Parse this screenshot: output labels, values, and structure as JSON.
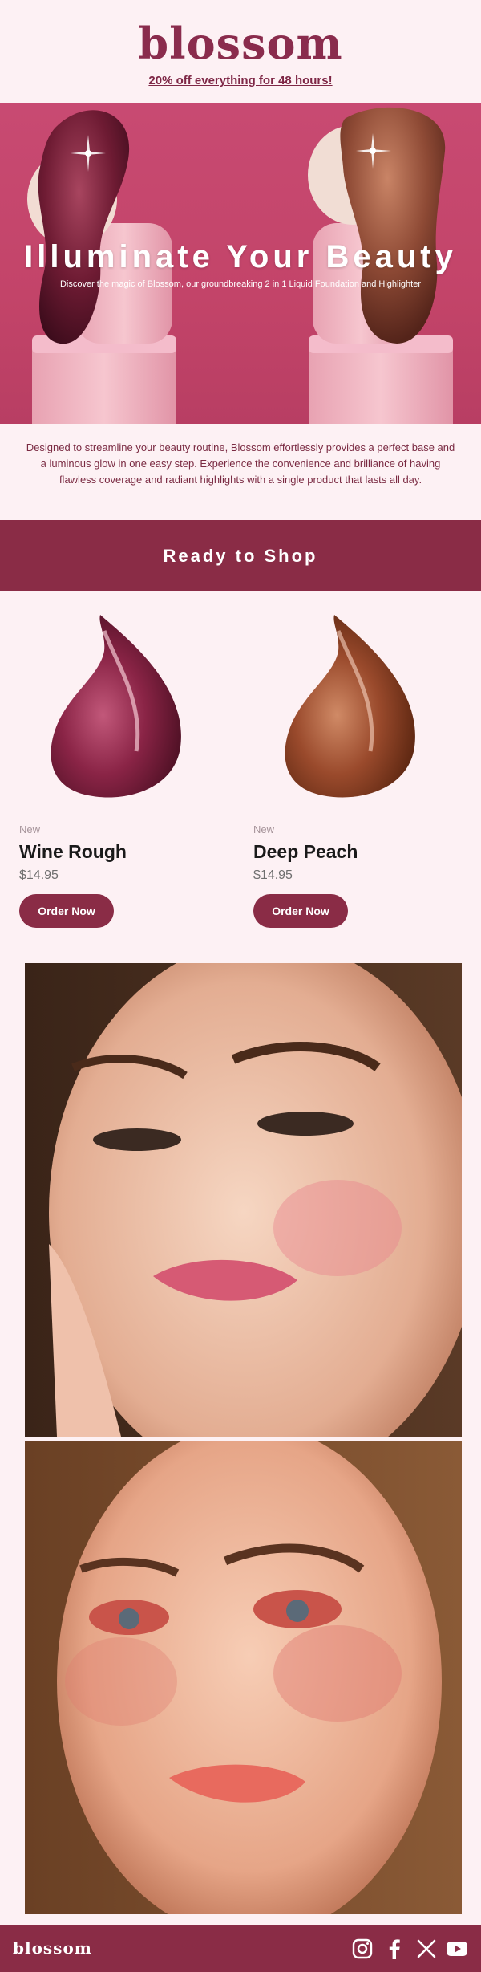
{
  "header": {
    "logo": "blossom",
    "promo": "20% off everything for 48 hours!"
  },
  "hero": {
    "title": "Illuminate Your Beauty",
    "subtitle": "Discover the magic of Blossom, our groundbreaking 2 in 1 Liquid Foundation and Highlighter"
  },
  "intro": {
    "text": "Designed to streamline your beauty routine, Blossom effortlessly provides a perfect base and a luminous glow in one easy step. Experience the convenience and brilliance of having flawless coverage and radiant highlights with a single product that lasts all day."
  },
  "shop": {
    "heading": "Ready to Shop"
  },
  "products": [
    {
      "badge": "New",
      "name": "Wine Rough",
      "price": "$14.95",
      "button": "Order Now",
      "color": "#7a1d3a"
    },
    {
      "badge": "New",
      "name": "Deep Peach",
      "price": "$14.95",
      "button": "Order Now",
      "color": "#8e3f26"
    }
  ],
  "footer": {
    "logo": "blossom",
    "social": [
      "instagram-icon",
      "facebook-icon",
      "x-icon",
      "youtube-icon"
    ]
  },
  "colors": {
    "brand": "#8a2c46",
    "hero": "#c84a72",
    "background": "#fdf1f4"
  }
}
